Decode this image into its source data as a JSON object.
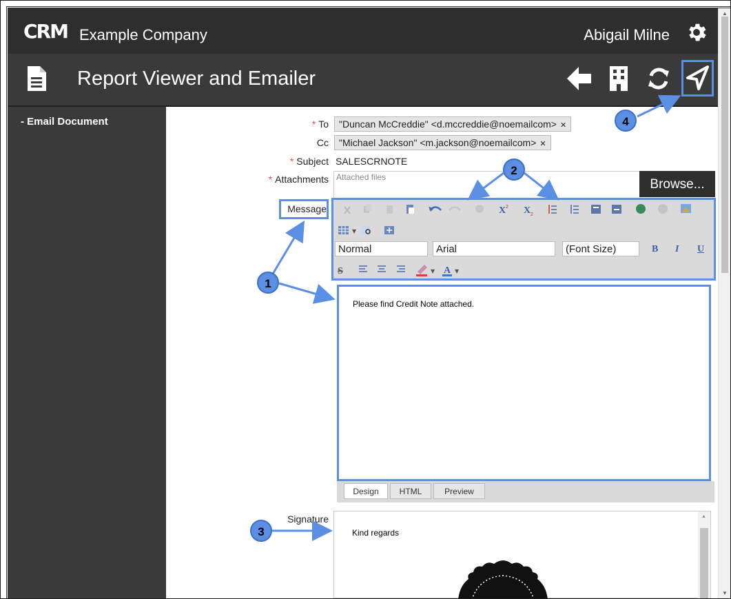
{
  "app": {
    "logo": "CRM",
    "company": "Example Company",
    "user": "Abigail Milne"
  },
  "page": {
    "title": "Report Viewer and Emailer"
  },
  "sidebar": {
    "items": [
      {
        "label": "Email Document"
      }
    ]
  },
  "form": {
    "to": {
      "label": "To",
      "recipients": [
        "\"Duncan McCreddie\" <d.mccreddie@noemailcom>"
      ]
    },
    "cc": {
      "label": "Cc",
      "recipients": [
        "\"Michael Jackson\" <m.jackson@noemailcom>"
      ]
    },
    "subject": {
      "label": "Subject",
      "value": "SALESCRNOTE"
    },
    "attachments": {
      "label": "Attachments",
      "placeholder": "Attached files",
      "browse_label": "Browse..."
    },
    "message": {
      "label": "Message",
      "style_select": "Normal",
      "font_select": "Arial",
      "size_select": "(Font Size)",
      "bold": "B",
      "italic": "I",
      "underline": "U",
      "body": "Please find Credit Note attached.",
      "tabs": [
        "Design",
        "HTML",
        "Preview"
      ]
    },
    "signature": {
      "label": "Signature",
      "body": "Kind regards"
    }
  },
  "callouts": [
    "1",
    "2",
    "3",
    "4"
  ],
  "colors": {
    "callout": "#5b8fe3",
    "topbar": "#2e2e2e",
    "titlebar": "#3a3a3a",
    "required": "#d9534f"
  }
}
